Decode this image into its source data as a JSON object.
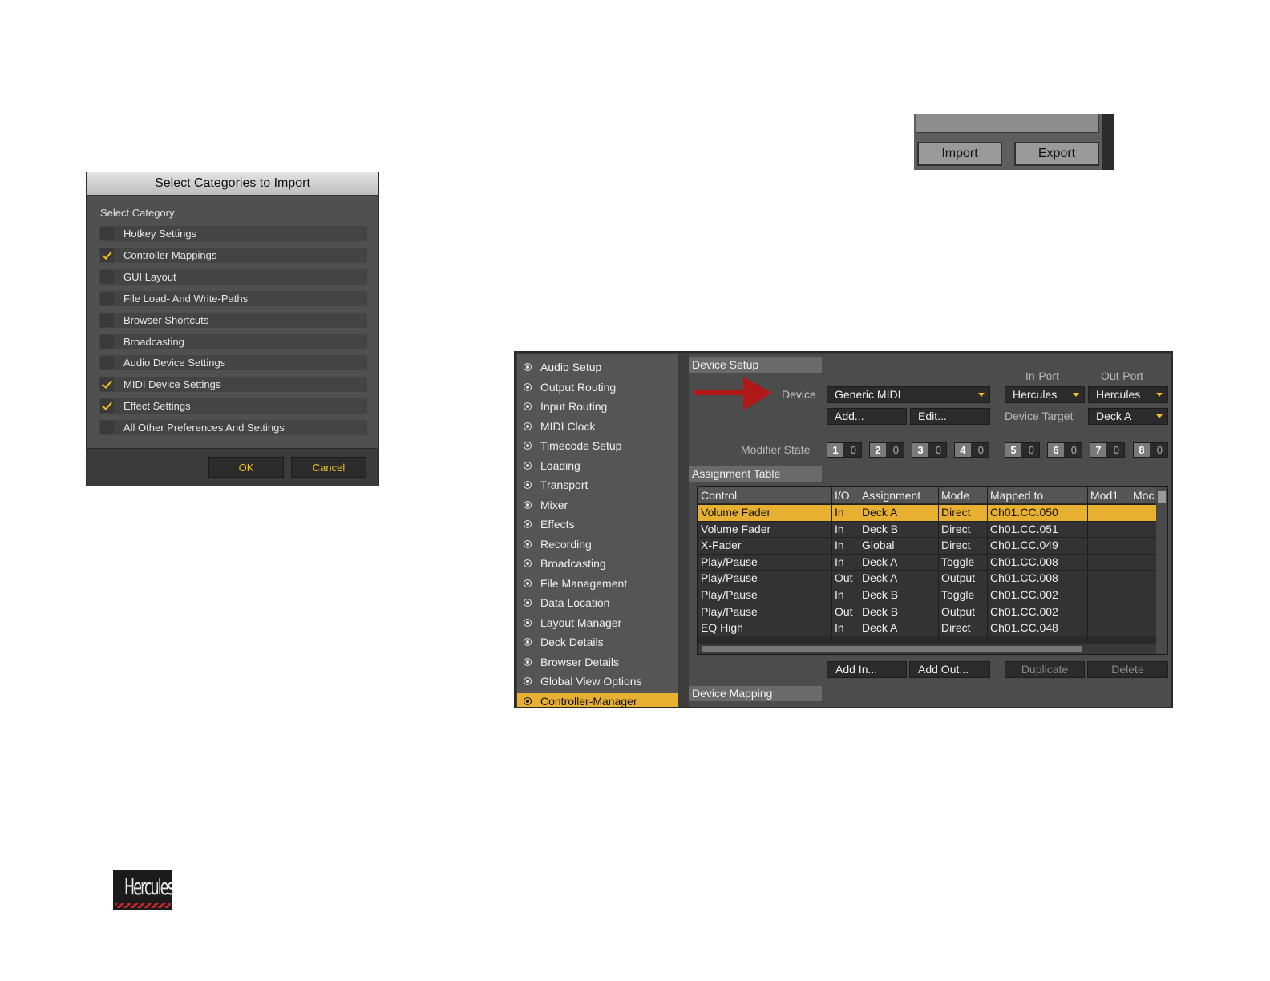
{
  "import_dialog": {
    "title": "Select Categories to Import",
    "subhead": "Select Category",
    "categories": [
      {
        "label": "Hotkey Settings",
        "checked": false
      },
      {
        "label": "Controller Mappings",
        "checked": true
      },
      {
        "label": "GUI Layout",
        "checked": false
      },
      {
        "label": "File Load- And Write-Paths",
        "checked": false
      },
      {
        "label": "Browser Shortcuts",
        "checked": false
      },
      {
        "label": "Broadcasting",
        "checked": false
      },
      {
        "label": "Audio Device Settings",
        "checked": false
      },
      {
        "label": "MIDI Device Settings",
        "checked": true
      },
      {
        "label": "Effect Settings",
        "checked": true
      },
      {
        "label": "All Other Preferences And Settings",
        "checked": false
      }
    ],
    "ok_label": "OK",
    "cancel_label": "Cancel",
    "accent_color": "#f0c020"
  },
  "import_export": {
    "import_label": "Import",
    "export_label": "Export"
  },
  "prefs": {
    "sidebar": [
      "Audio Setup",
      "Output Routing",
      "Input Routing",
      "MIDI Clock",
      "Timecode Setup",
      "Loading",
      "Transport",
      "Mixer",
      "Effects",
      "Recording",
      "Broadcasting",
      "File Management",
      "Data Location",
      "Layout Manager",
      "Deck Details",
      "Browser Details",
      "Global View Options",
      "Controller-Manager"
    ],
    "sidebar_selected": "Controller-Manager",
    "device_setup": {
      "heading": "Device Setup",
      "in_port_label": "In-Port",
      "out_port_label": "Out-Port",
      "device_label": "Device",
      "device_value": "Generic MIDI",
      "in_port_value": "Hercules",
      "out_port_value": "Hercules",
      "add_label": "Add...",
      "edit_label": "Edit...",
      "device_target_label": "Device Target",
      "device_target_value": "Deck A",
      "modifier_state_label": "Modifier State",
      "modifiers": [
        {
          "n": "1",
          "v": "0"
        },
        {
          "n": "2",
          "v": "0"
        },
        {
          "n": "3",
          "v": "0"
        },
        {
          "n": "4",
          "v": "0"
        },
        {
          "n": "5",
          "v": "0"
        },
        {
          "n": "6",
          "v": "0"
        },
        {
          "n": "7",
          "v": "0"
        },
        {
          "n": "8",
          "v": "0"
        }
      ]
    },
    "assignment_table": {
      "heading": "Assignment Table",
      "columns": [
        "Control",
        "I/O",
        "Assignment",
        "Mode",
        "Mapped to",
        "Mod1",
        "Moc"
      ],
      "rows": [
        [
          "Volume Fader",
          "In",
          "Deck A",
          "Direct",
          "Ch01.CC.050"
        ],
        [
          "Volume Fader",
          "In",
          "Deck B",
          "Direct",
          "Ch01.CC.051"
        ],
        [
          "X-Fader",
          "In",
          "Global",
          "Direct",
          "Ch01.CC.049"
        ],
        [
          "Play/Pause",
          "In",
          "Deck A",
          "Toggle",
          "Ch01.CC.008"
        ],
        [
          "Play/Pause",
          "Out",
          "Deck A",
          "Output",
          "Ch01.CC.008"
        ],
        [
          "Play/Pause",
          "In",
          "Deck B",
          "Toggle",
          "Ch01.CC.002"
        ],
        [
          "Play/Pause",
          "Out",
          "Deck B",
          "Output",
          "Ch01.CC.002"
        ],
        [
          "EQ High",
          "In",
          "Deck A",
          "Direct",
          "Ch01.CC.048"
        ]
      ],
      "selected_row": 0,
      "add_in_label": "Add In...",
      "add_out_label": "Add Out...",
      "duplicate_label": "Duplicate",
      "delete_label": "Delete"
    },
    "device_mapping_heading": "Device Mapping",
    "highlight_color": "#e8b030",
    "arrow_color": "#b01818"
  },
  "logo": {
    "text": "Hercules"
  }
}
